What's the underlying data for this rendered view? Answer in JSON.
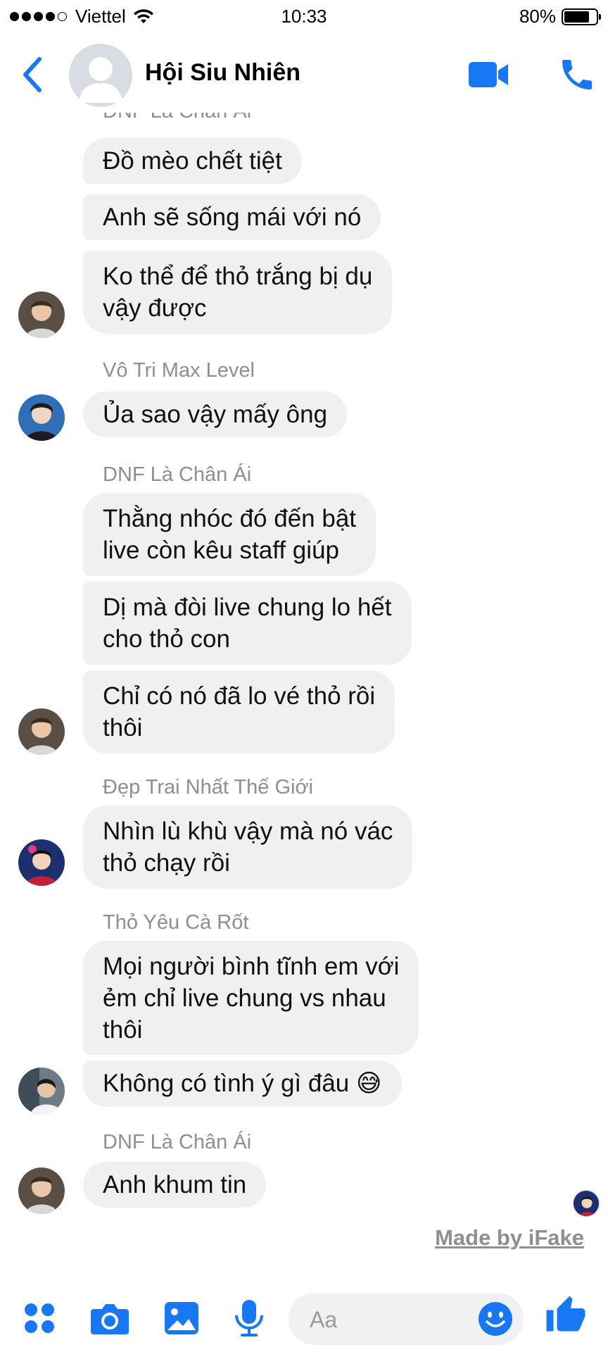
{
  "status_bar": {
    "carrier": "Viettel",
    "time": "10:33",
    "battery": "80%",
    "battery_level": 0.8
  },
  "header": {
    "title": "Hội Siu Nhiên"
  },
  "messages": {
    "partial_sender_1": "DNF Là Chân Ái",
    "b1": "Đồ mèo chết tiệt",
    "b2": "Anh sẽ sống mái với nó",
    "b3_l1": "Ko thể để thỏ trắng bị dụ",
    "b3_l2": "vậy được",
    "sender_2": "Vô Tri Max Level",
    "b4": "Ủa sao vậy mấy ông",
    "sender_3": "DNF Là Chân Ái",
    "b5_l1": "Thằng nhóc đó đến bật",
    "b5_l2": "live còn kêu staff giúp",
    "b6_l1": "Dị mà đòi live chung lo hết",
    "b6_l2": "cho thỏ con",
    "b7_l1": "Chỉ có nó đã lo vé thỏ rồi",
    "b7_l2": "thôi",
    "sender_4": "Đẹp Trai Nhất Thế Giới",
    "b8_l1": "Nhìn lù khù vậy mà nó vác",
    "b8_l2": "thỏ chạy rồi",
    "sender_5": "Thỏ Yêu Cà Rốt",
    "b9_l1": "Mọi người bình tĩnh em với",
    "b9_l2": "ẻm chỉ live chung vs nhau",
    "b9_l3": "thôi",
    "b10": "Không có tình ý gì đâu",
    "b10_emoji": "😅",
    "sender_6": "DNF Là Chân Ái",
    "b11": "Anh khum tin"
  },
  "watermark": "Made by iFake",
  "composer": {
    "placeholder": "Aa",
    "icons": [
      "apps-icon",
      "camera-icon",
      "image-icon",
      "microphone-icon",
      "emoji-icon",
      "thumbs-up-icon"
    ]
  },
  "colors": {
    "accent": "#1877f2",
    "bubble": "#f0f0f0",
    "sender_text": "#8e8e93"
  }
}
